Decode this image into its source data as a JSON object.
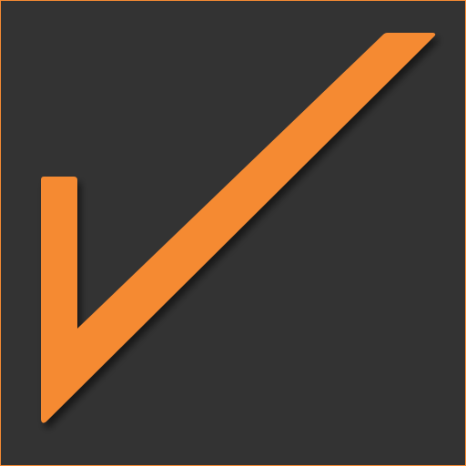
{
  "icon": {
    "name": "checkmark-icon",
    "colors": {
      "background": "#333333",
      "accent": "#f58a33",
      "shadow": "#000000"
    }
  }
}
